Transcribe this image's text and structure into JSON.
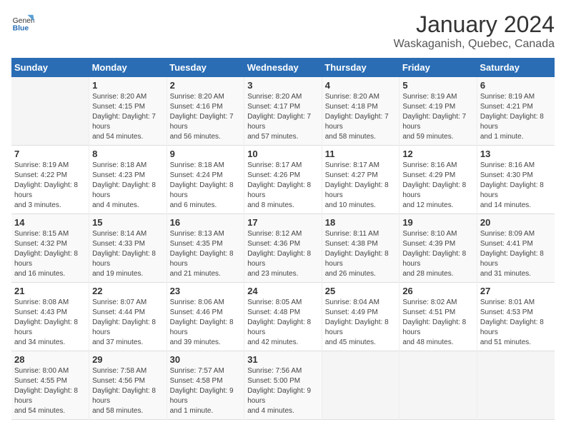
{
  "header": {
    "logo_general": "General",
    "logo_blue": "Blue",
    "title": "January 2024",
    "subtitle": "Waskaganish, Quebec, Canada"
  },
  "days_of_week": [
    "Sunday",
    "Monday",
    "Tuesday",
    "Wednesday",
    "Thursday",
    "Friday",
    "Saturday"
  ],
  "weeks": [
    [
      {
        "day": "",
        "sunrise": "",
        "sunset": "",
        "daylight": ""
      },
      {
        "day": "1",
        "sunrise": "Sunrise: 8:20 AM",
        "sunset": "Sunset: 4:15 PM",
        "daylight": "Daylight: 7 hours and 54 minutes."
      },
      {
        "day": "2",
        "sunrise": "Sunrise: 8:20 AM",
        "sunset": "Sunset: 4:16 PM",
        "daylight": "Daylight: 7 hours and 56 minutes."
      },
      {
        "day": "3",
        "sunrise": "Sunrise: 8:20 AM",
        "sunset": "Sunset: 4:17 PM",
        "daylight": "Daylight: 7 hours and 57 minutes."
      },
      {
        "day": "4",
        "sunrise": "Sunrise: 8:20 AM",
        "sunset": "Sunset: 4:18 PM",
        "daylight": "Daylight: 7 hours and 58 minutes."
      },
      {
        "day": "5",
        "sunrise": "Sunrise: 8:19 AM",
        "sunset": "Sunset: 4:19 PM",
        "daylight": "Daylight: 7 hours and 59 minutes."
      },
      {
        "day": "6",
        "sunrise": "Sunrise: 8:19 AM",
        "sunset": "Sunset: 4:21 PM",
        "daylight": "Daylight: 8 hours and 1 minute."
      }
    ],
    [
      {
        "day": "7",
        "sunrise": "Sunrise: 8:19 AM",
        "sunset": "Sunset: 4:22 PM",
        "daylight": "Daylight: 8 hours and 3 minutes."
      },
      {
        "day": "8",
        "sunrise": "Sunrise: 8:18 AM",
        "sunset": "Sunset: 4:23 PM",
        "daylight": "Daylight: 8 hours and 4 minutes."
      },
      {
        "day": "9",
        "sunrise": "Sunrise: 8:18 AM",
        "sunset": "Sunset: 4:24 PM",
        "daylight": "Daylight: 8 hours and 6 minutes."
      },
      {
        "day": "10",
        "sunrise": "Sunrise: 8:17 AM",
        "sunset": "Sunset: 4:26 PM",
        "daylight": "Daylight: 8 hours and 8 minutes."
      },
      {
        "day": "11",
        "sunrise": "Sunrise: 8:17 AM",
        "sunset": "Sunset: 4:27 PM",
        "daylight": "Daylight: 8 hours and 10 minutes."
      },
      {
        "day": "12",
        "sunrise": "Sunrise: 8:16 AM",
        "sunset": "Sunset: 4:29 PM",
        "daylight": "Daylight: 8 hours and 12 minutes."
      },
      {
        "day": "13",
        "sunrise": "Sunrise: 8:16 AM",
        "sunset": "Sunset: 4:30 PM",
        "daylight": "Daylight: 8 hours and 14 minutes."
      }
    ],
    [
      {
        "day": "14",
        "sunrise": "Sunrise: 8:15 AM",
        "sunset": "Sunset: 4:32 PM",
        "daylight": "Daylight: 8 hours and 16 minutes."
      },
      {
        "day": "15",
        "sunrise": "Sunrise: 8:14 AM",
        "sunset": "Sunset: 4:33 PM",
        "daylight": "Daylight: 8 hours and 19 minutes."
      },
      {
        "day": "16",
        "sunrise": "Sunrise: 8:13 AM",
        "sunset": "Sunset: 4:35 PM",
        "daylight": "Daylight: 8 hours and 21 minutes."
      },
      {
        "day": "17",
        "sunrise": "Sunrise: 8:12 AM",
        "sunset": "Sunset: 4:36 PM",
        "daylight": "Daylight: 8 hours and 23 minutes."
      },
      {
        "day": "18",
        "sunrise": "Sunrise: 8:11 AM",
        "sunset": "Sunset: 4:38 PM",
        "daylight": "Daylight: 8 hours and 26 minutes."
      },
      {
        "day": "19",
        "sunrise": "Sunrise: 8:10 AM",
        "sunset": "Sunset: 4:39 PM",
        "daylight": "Daylight: 8 hours and 28 minutes."
      },
      {
        "day": "20",
        "sunrise": "Sunrise: 8:09 AM",
        "sunset": "Sunset: 4:41 PM",
        "daylight": "Daylight: 8 hours and 31 minutes."
      }
    ],
    [
      {
        "day": "21",
        "sunrise": "Sunrise: 8:08 AM",
        "sunset": "Sunset: 4:43 PM",
        "daylight": "Daylight: 8 hours and 34 minutes."
      },
      {
        "day": "22",
        "sunrise": "Sunrise: 8:07 AM",
        "sunset": "Sunset: 4:44 PM",
        "daylight": "Daylight: 8 hours and 37 minutes."
      },
      {
        "day": "23",
        "sunrise": "Sunrise: 8:06 AM",
        "sunset": "Sunset: 4:46 PM",
        "daylight": "Daylight: 8 hours and 39 minutes."
      },
      {
        "day": "24",
        "sunrise": "Sunrise: 8:05 AM",
        "sunset": "Sunset: 4:48 PM",
        "daylight": "Daylight: 8 hours and 42 minutes."
      },
      {
        "day": "25",
        "sunrise": "Sunrise: 8:04 AM",
        "sunset": "Sunset: 4:49 PM",
        "daylight": "Daylight: 8 hours and 45 minutes."
      },
      {
        "day": "26",
        "sunrise": "Sunrise: 8:02 AM",
        "sunset": "Sunset: 4:51 PM",
        "daylight": "Daylight: 8 hours and 48 minutes."
      },
      {
        "day": "27",
        "sunrise": "Sunrise: 8:01 AM",
        "sunset": "Sunset: 4:53 PM",
        "daylight": "Daylight: 8 hours and 51 minutes."
      }
    ],
    [
      {
        "day": "28",
        "sunrise": "Sunrise: 8:00 AM",
        "sunset": "Sunset: 4:55 PM",
        "daylight": "Daylight: 8 hours and 54 minutes."
      },
      {
        "day": "29",
        "sunrise": "Sunrise: 7:58 AM",
        "sunset": "Sunset: 4:56 PM",
        "daylight": "Daylight: 8 hours and 58 minutes."
      },
      {
        "day": "30",
        "sunrise": "Sunrise: 7:57 AM",
        "sunset": "Sunset: 4:58 PM",
        "daylight": "Daylight: 9 hours and 1 minute."
      },
      {
        "day": "31",
        "sunrise": "Sunrise: 7:56 AM",
        "sunset": "Sunset: 5:00 PM",
        "daylight": "Daylight: 9 hours and 4 minutes."
      },
      {
        "day": "",
        "sunrise": "",
        "sunset": "",
        "daylight": ""
      },
      {
        "day": "",
        "sunrise": "",
        "sunset": "",
        "daylight": ""
      },
      {
        "day": "",
        "sunrise": "",
        "sunset": "",
        "daylight": ""
      }
    ]
  ]
}
